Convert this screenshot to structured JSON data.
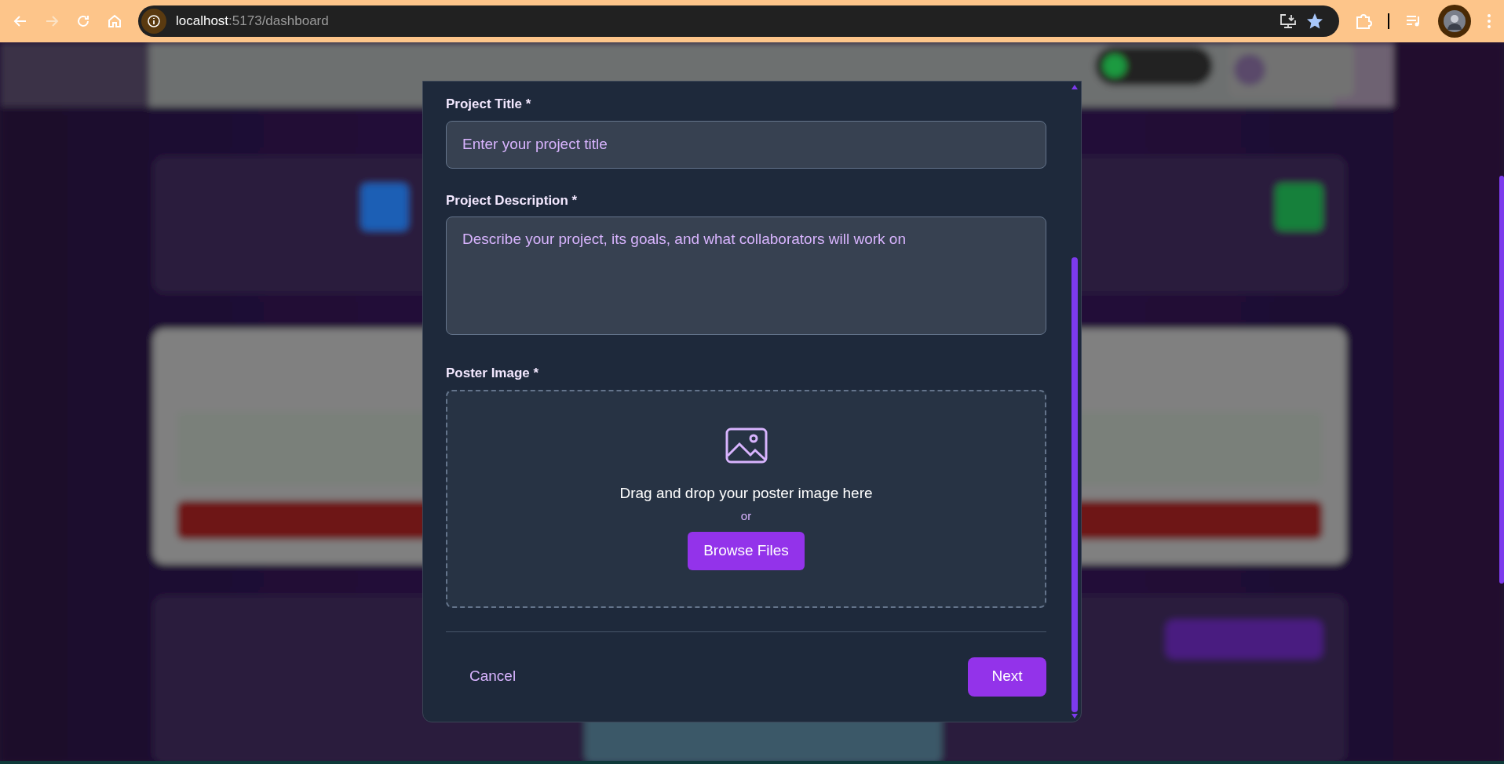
{
  "browser": {
    "url_host": "localhost",
    "url_path": ":5173/dashboard"
  },
  "modal": {
    "fields": [
      {
        "kind": "input",
        "label": "Project Title *",
        "placeholder": "Enter your project title"
      },
      {
        "kind": "textarea",
        "label": "Project Description *",
        "placeholder": "Describe your project, its goals, and what collaborators will work on"
      }
    ],
    "upload": {
      "label": "Poster Image *",
      "prompt": "Drag and drop your poster image here",
      "separator": "or",
      "button": "Browse Files"
    },
    "footer": {
      "cancel": "Cancel",
      "next": "Next"
    }
  }
}
